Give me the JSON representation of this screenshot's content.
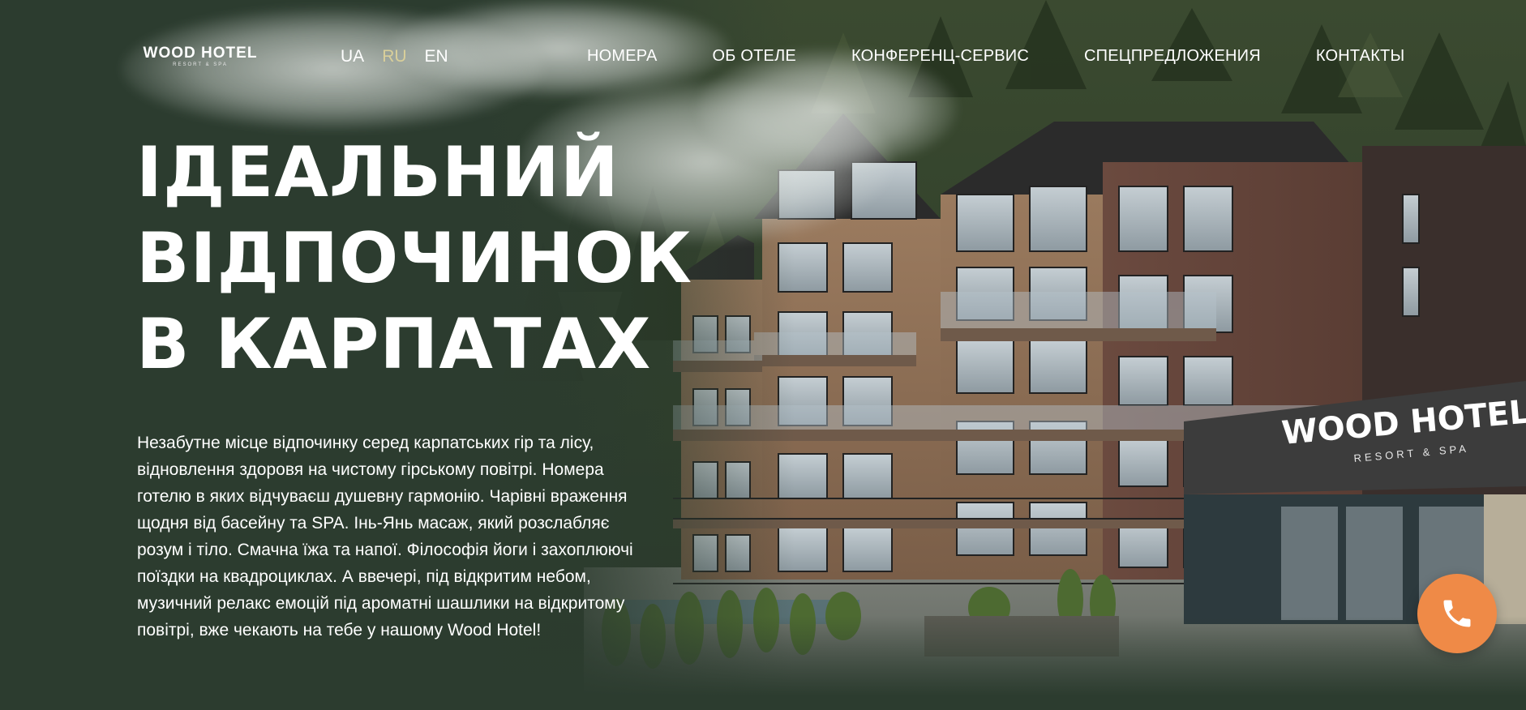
{
  "header": {
    "logo": {
      "name": "WOOD HOTEL",
      "tagline": "RESORT & SPA"
    },
    "languages": [
      {
        "label": "UA",
        "active": false
      },
      {
        "label": "RU",
        "active": true
      },
      {
        "label": "EN",
        "active": false
      }
    ],
    "nav": [
      {
        "label": "НОМЕРА"
      },
      {
        "label": "ОБ ОТЕЛЕ"
      },
      {
        "label": "КОНФЕРЕНЦ-СЕРВИС"
      },
      {
        "label": "СПЕЦПРЕДЛОЖЕНИЯ"
      },
      {
        "label": "КОНТАКТЫ"
      }
    ]
  },
  "hero": {
    "headline_lines": [
      "ІДЕАЛЬНИЙ",
      "ВІДПОЧИНОК",
      "В КАРПАТАХ"
    ],
    "description": "Незабутне місце відпочинку серед карпатських гір та лісу, відновлення здоровя на чистому гірському повітрі. Номера готелю в яких відчуваєш душевну гармонію. Чарівні враження щодня від басейну та SPA. Інь-Янь масаж, який розслабляє розум і тіло. Смачна їжа та напої. Філософія йоги і захоплюючі поїздки на квадроциклах. А ввечері, під відкритим небом, музичний релакс емоцій під ароматні шашлики на відкритому повітрі, вже чекають на тебе у нашому Wood Hotel!",
    "building_sign": {
      "name": "WOOD HOTEL",
      "tagline": "RESORT & SPA"
    }
  },
  "colors": {
    "background": "#2c3c2f",
    "active_language": "#d9cf9a",
    "call_button": "#ef8a47"
  },
  "icons": {
    "call_button": "phone-icon"
  }
}
